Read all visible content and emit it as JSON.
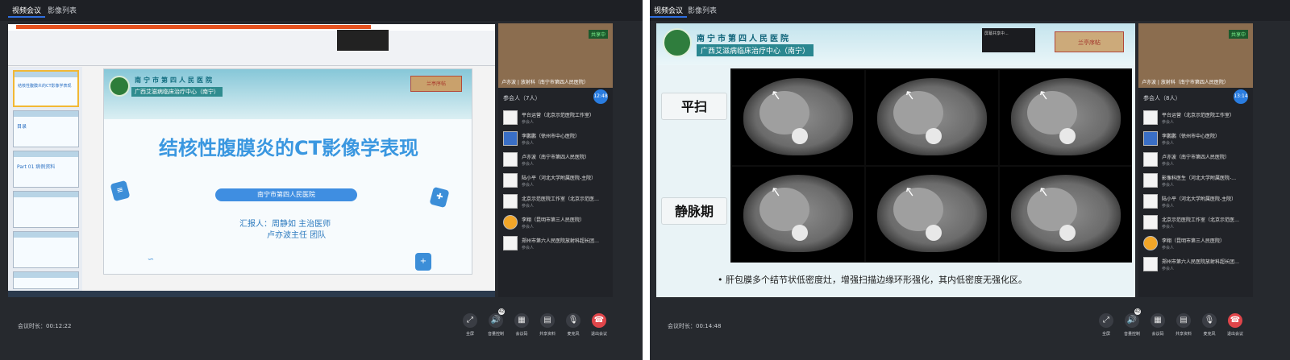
{
  "left": {
    "tabs": [
      {
        "label": "视频会议",
        "active": true
      },
      {
        "label": "影像列表",
        "active": false
      }
    ],
    "ppt": {
      "thumbs": [
        "结核性腹膜炎的CT影像学表现",
        "目录",
        "Part 01 病例资料",
        "",
        "",
        "",
        ""
      ],
      "slide": {
        "hospital": "南宁市第四人民医院",
        "center": "广西艾滋病临床治疗中心（南宁）",
        "stamp": "兰亭序帖",
        "title": "结核性腹膜炎的CT影像学表现",
        "pill": "南宁市第四人民医院",
        "reporter": "汇报人：周静如  主治医师",
        "team": "卢亦波主任  团队"
      }
    },
    "video": {
      "label": "卢亦波 | 放射科（南宁市第四人民医院）",
      "share_badge": "共享中"
    },
    "timer": "12:48",
    "participants_header": "参会人（7人）",
    "participants": [
      {
        "name": "平台运营（北京示范医院工作室）",
        "role": "参会人",
        "avatar": "plain"
      },
      {
        "name": "李鹏鹏（徐州市中心医院）",
        "role": "参会人",
        "avatar": "blue"
      },
      {
        "name": "卢亦波（南宁市第四人民医院）",
        "role": "参会人",
        "avatar": "plain"
      },
      {
        "name": "陆小平（河北大学附属医院-主院）",
        "role": "参会人",
        "avatar": "plain"
      },
      {
        "name": "北京示范医院工作室（北京示范医…",
        "role": "参会人",
        "avatar": "plain"
      },
      {
        "name": "李翔（昆明市第三人民医院）",
        "role": "参会人",
        "avatar": "orange"
      },
      {
        "name": "郑州市第六人民医院放射科超长团…",
        "role": "参会人",
        "avatar": "plain"
      }
    ],
    "duration": "会议时长：00:12:22",
    "controls": [
      {
        "icon": "⤢",
        "label": "全屏",
        "name": "fullscreen"
      },
      {
        "icon": "🔊",
        "label": "音量控制",
        "name": "volume"
      },
      {
        "icon": "▦",
        "label": "会议码",
        "name": "meeting-code"
      },
      {
        "icon": "▤",
        "label": "共享资料",
        "name": "share-files"
      },
      {
        "icon": "🎙",
        "label": "麦克风",
        "name": "microphone"
      },
      {
        "icon": "☎",
        "label": "退出会议",
        "name": "leave-meeting"
      }
    ],
    "volume_badge": "42"
  },
  "right": {
    "tabs": [
      {
        "label": "视频会议",
        "active": true
      },
      {
        "label": "影像列表",
        "active": false
      }
    ],
    "slide": {
      "hospital": "南宁市第四人民医院",
      "center": "广西艾滋病临床治疗中心（南宁）",
      "popup": "屏幕共享中...",
      "stamp": "兰亭序帖",
      "label_top": "平扫",
      "label_bottom": "静脉期",
      "bullet": "•  肝包膜多个结节状低密度灶，增强扫描边缘环形强化，其内低密度无强化区。"
    },
    "video": {
      "label": "卢亦波 | 放射科（南宁市第四人民医院）",
      "share_badge": "共享中"
    },
    "timer": "13:14",
    "participants_header": "参会人（8人）",
    "participants": [
      {
        "name": "平台运营（北京示范医院工作室）",
        "role": "参会人",
        "avatar": "plain"
      },
      {
        "name": "李鹏鹏（徐州市中心医院）",
        "role": "参会人",
        "avatar": "blue"
      },
      {
        "name": "卢亦波（南宁市第四人民医院）",
        "role": "参会人",
        "avatar": "plain"
      },
      {
        "name": "影像科医生（河北大学附属医院-…",
        "role": "参会人",
        "avatar": "plain"
      },
      {
        "name": "陆小平（河北大学附属医院-主院）",
        "role": "参会人",
        "avatar": "plain"
      },
      {
        "name": "北京示范医院工作室（北京示范医…",
        "role": "参会人",
        "avatar": "plain"
      },
      {
        "name": "李翔（昆明市第三人民医院）",
        "role": "参会人",
        "avatar": "orange"
      },
      {
        "name": "郑州市第六人民医院放射科超长团…",
        "role": "参会人",
        "avatar": "plain"
      }
    ],
    "duration": "会议时长：00:14:48",
    "controls": [
      {
        "icon": "⤢",
        "label": "全屏",
        "name": "fullscreen"
      },
      {
        "icon": "🔊",
        "label": "音量控制",
        "name": "volume"
      },
      {
        "icon": "▦",
        "label": "会议码",
        "name": "meeting-code"
      },
      {
        "icon": "▤",
        "label": "共享资料",
        "name": "share-files"
      },
      {
        "icon": "🎙",
        "label": "麦克风",
        "name": "microphone"
      },
      {
        "icon": "☎",
        "label": "退出会议",
        "name": "leave-meeting"
      }
    ],
    "volume_badge": "42"
  }
}
